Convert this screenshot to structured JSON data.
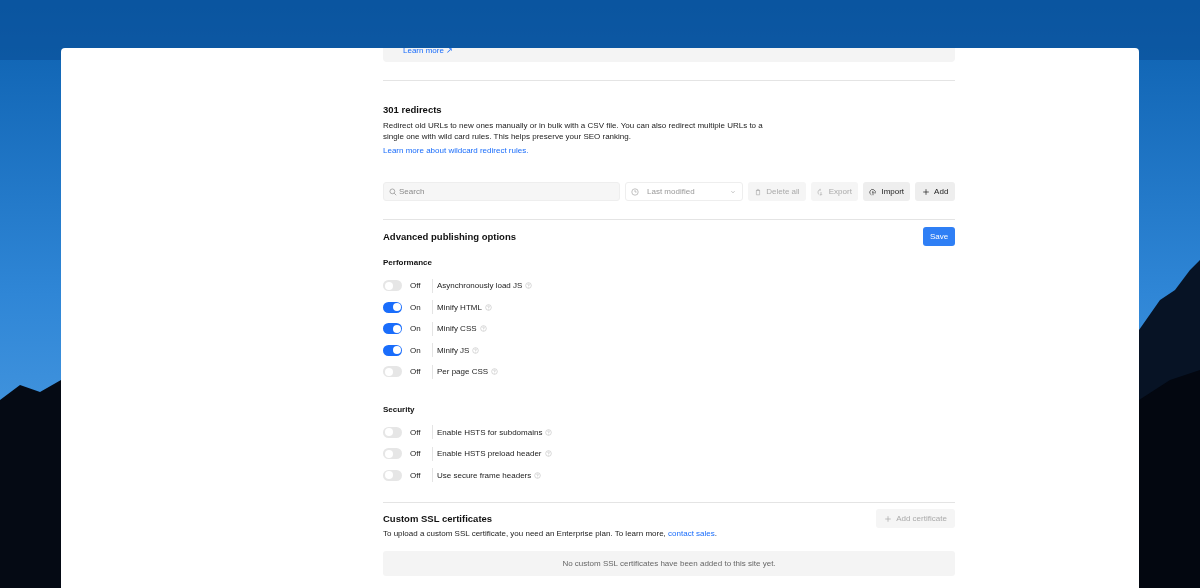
{
  "top_panel": {
    "link": "Learn more ↗"
  },
  "redirects": {
    "title": "301 redirects",
    "description": "Redirect old URLs to new ones manually or in bulk with a CSV file. You can also redirect multiple URLs to a single one with wild card rules. This helps preserve your SEO ranking.",
    "link": "Learn more about wildcard redirect rules.",
    "search": {
      "placeholder": "Search"
    },
    "sort": {
      "value": "Last modified"
    },
    "buttons": [
      {
        "kind": "delete",
        "label": "Delete all",
        "disabled": true
      },
      {
        "kind": "export",
        "label": "Export",
        "disabled": true
      },
      {
        "kind": "import",
        "label": "Import",
        "disabled": false
      },
      {
        "kind": "add",
        "label": "Add",
        "disabled": false
      }
    ]
  },
  "advanced": {
    "title": "Advanced publishing options",
    "save": "Save",
    "groups": [
      {
        "title": "Performance",
        "options": [
          {
            "state_label": "Off",
            "label": "Asynchronously load JS",
            "on": false
          },
          {
            "state_label": "On",
            "label": "Minify HTML",
            "on": true
          },
          {
            "state_label": "On",
            "label": "Minify CSS",
            "on": true
          },
          {
            "state_label": "On",
            "label": "Minify JS",
            "on": true
          },
          {
            "state_label": "Off",
            "label": "Per page CSS",
            "on": false
          }
        ]
      },
      {
        "title": "Security",
        "options": [
          {
            "state_label": "Off",
            "label": "Enable HSTS for subdomains",
            "on": false
          },
          {
            "state_label": "Off",
            "label": "Enable HSTS preload header",
            "on": false
          },
          {
            "state_label": "Off",
            "label": "Use secure frame headers",
            "on": false
          }
        ]
      }
    ]
  },
  "ssl": {
    "title": "Custom SSL certificates",
    "add_button": {
      "label": "Add certificate",
      "disabled": true
    },
    "link": "contact sales",
    "text_before": "To upload a custom SSL certificate, you need an Enterprise plan. To learn more, ",
    "text_after": ".",
    "empty": "No custom SSL certificates have been added to this site yet."
  }
}
